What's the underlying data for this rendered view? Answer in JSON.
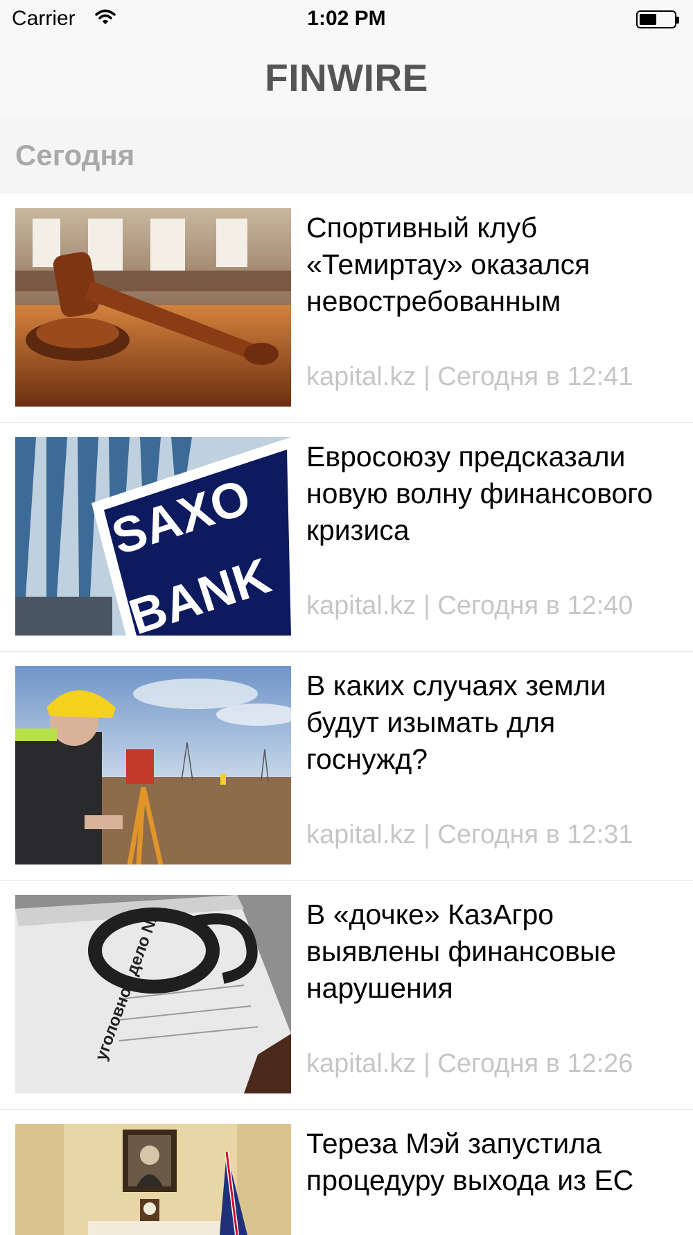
{
  "status_bar": {
    "carrier": "Carrier",
    "time": "1:02 PM",
    "wifi_icon": "wifi-icon",
    "battery_icon": "battery-icon"
  },
  "nav": {
    "title": "FINWIRE"
  },
  "section": {
    "title": "Сегодня"
  },
  "articles": [
    {
      "title": "Спортивный клуб «Темиртау» оказался невостребованным",
      "meta": "kapital.kz | Сегодня в 12:41",
      "image": "gavel-image"
    },
    {
      "title": "Евросоюзу предсказали новую волну финансового кризиса",
      "meta": "kapital.kz | Сегодня в 12:40",
      "image": "saxo-bank-image",
      "image_text": [
        "SAXO",
        "BANK"
      ]
    },
    {
      "title": "В каких случаях земли будут изымать для госнужд?",
      "meta": "kapital.kz | Сегодня в 12:31",
      "image": "surveyor-image"
    },
    {
      "title": "В «дочке» КазАгро выявлены финансовые нарушения",
      "meta": "kapital.kz | Сегодня в 12:26",
      "image": "handcuffs-image",
      "image_text": [
        "уголовное дело №"
      ]
    },
    {
      "title": "Тереза Мэй запустила процедуру выхода из ЕС",
      "meta": "",
      "image": "parliament-room-image"
    }
  ],
  "colors": {
    "nav_title": "#555555",
    "section_title": "#a9a9a9",
    "meta_text": "#c6c6c6",
    "separator": "#ececec",
    "header_bg": "#f8f8f8"
  }
}
